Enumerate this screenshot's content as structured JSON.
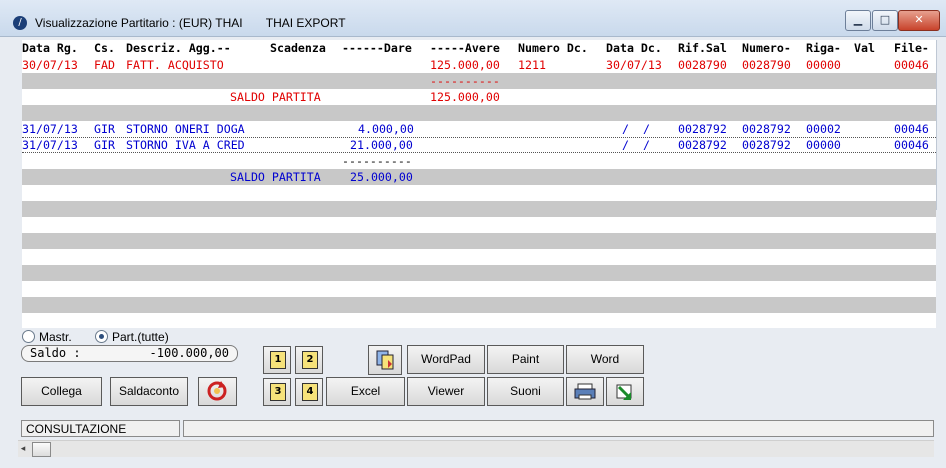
{
  "window": {
    "title": "Visualizzazione Partitario : (EUR) THAI       THAI EXPORT",
    "minimize": "▁",
    "maximize": "□",
    "close": "✕"
  },
  "grid": {
    "header": {
      "data_rg": "Data Rg.",
      "cs": "Cs.",
      "descriz": "Descriz. Agg.--",
      "scadenza": "Scadenza",
      "dare": "------Dare",
      "avere": "-----Avere",
      "numero_dc": "Numero Dc.",
      "data_dc": "Data Dc.",
      "rif_sal": "Rif.Sal",
      "numero": "Numero-",
      "riga": "Riga-",
      "val": "Val",
      "file": "File-"
    },
    "rows": [
      {
        "data_rg": "30/07/13",
        "cs": "FAD",
        "descriz": "FATT. ACQUISTO",
        "avere": "125.000,00",
        "numero_dc": "1211",
        "data_dc": "30/07/13",
        "rif_sal": "0028790",
        "numero": "0028790",
        "riga": "00000",
        "file": "00046"
      },
      {
        "avere_sep": "----------"
      },
      {
        "saldo_label": "SALDO PARTITA",
        "avere": "125.000,00"
      },
      {
        "data_rg": "31/07/13",
        "cs": "GIR",
        "descriz": "STORNO ONERI DOGA",
        "dare": "4.000,00",
        "data_dc": "/  /",
        "rif_sal": "0028792",
        "numero": "0028792",
        "riga": "00002",
        "file": "00046"
      },
      {
        "data_rg": "31/07/13",
        "cs": "GIR",
        "descriz": "STORNO IVA A CRED",
        "dare": "21.000,00",
        "data_dc": "/  /",
        "rif_sal": "0028792",
        "numero": "0028792",
        "riga": "00000",
        "file": "00046"
      },
      {
        "dare_sep": "----------"
      },
      {
        "saldo_label": "SALDO PARTITA",
        "dare": "25.000,00"
      }
    ]
  },
  "options": {
    "mastr_label": "Mastr.",
    "part_label": "Part.(tutte)",
    "selected": "part"
  },
  "saldo": {
    "label": "Saldo  :",
    "value": "-100.000,00"
  },
  "buttons": {
    "collega": "Collega",
    "saldaconto": "Saldaconto",
    "wordpad": "WordPad",
    "paint": "Paint",
    "word": "Word",
    "excel": "Excel",
    "viewer": "Viewer",
    "suoni": "Suoni",
    "page1": "1",
    "page2": "2",
    "page3": "3",
    "page4": "4"
  },
  "status": {
    "mode": "CONSULTAZIONE",
    "info": ""
  },
  "colors": {
    "red_text": "#e00000",
    "blue_text": "#0000d0",
    "stripe": "#c8c8c8"
  },
  "icons": [
    "app-icon",
    "refresh-icon",
    "copy-pages-icon",
    "print-icon",
    "export-arrow-icon",
    "page-icon"
  ]
}
